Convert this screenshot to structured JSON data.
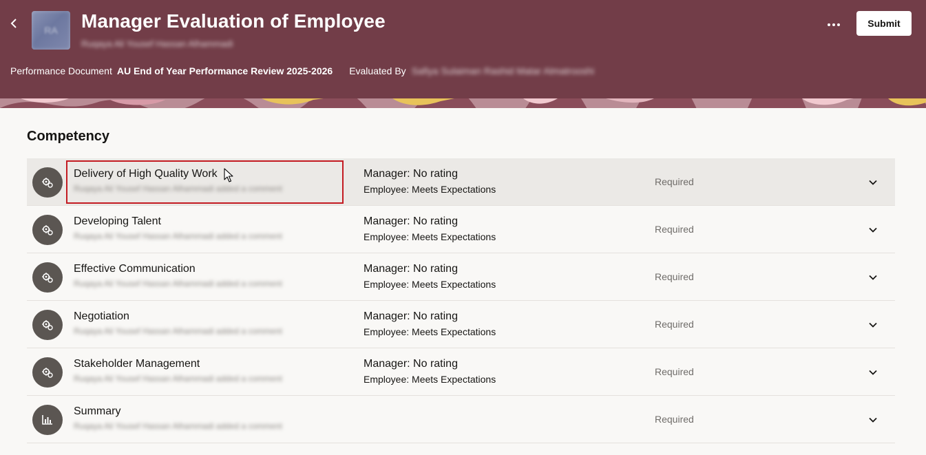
{
  "header": {
    "back_icon": "chevron-left-icon",
    "avatar_initials": "RA",
    "title": "Manager Evaluation of Employee",
    "subtitle": "Ruqaya Ali Yousef Hassan Alhammadi",
    "more_icon": "ellipsis-icon",
    "submit_label": "Submit",
    "performance_document_label": "Performance Document",
    "performance_document_value": "AU End of Year Performance Review 2025-2026",
    "evaluated_by_label": "Evaluated By",
    "evaluated_by_value": "Safiya Sulaiman Rashid Matar Almatrooshi",
    "background_color": "#723d48"
  },
  "main": {
    "section_title": "Competency",
    "rows": [
      {
        "name": "Delivery of High Quality Work",
        "comment": "Ruqaya Ali Yousef Hassan Alhammadi added a comment",
        "manager_rating": "Manager: No rating",
        "employee_rating": "Employee: Meets Expectations",
        "status": "Required",
        "icon": "competency-gear-icon",
        "selected": true
      },
      {
        "name": "Developing Talent",
        "comment": "Ruqaya Ali Yousef Hassan Alhammadi added a comment",
        "manager_rating": "Manager: No rating",
        "employee_rating": "Employee: Meets Expectations",
        "status": "Required",
        "icon": "competency-gear-icon"
      },
      {
        "name": "Effective Communication",
        "comment": "Ruqaya Ali Yousef Hassan Alhammadi added a comment",
        "manager_rating": "Manager: No rating",
        "employee_rating": "Employee: Meets Expectations",
        "status": "Required",
        "icon": "competency-gear-icon"
      },
      {
        "name": "Negotiation",
        "comment": "Ruqaya Ali Yousef Hassan Alhammadi added a comment",
        "manager_rating": "Manager: No rating",
        "employee_rating": "Employee: Meets Expectations",
        "status": "Required",
        "icon": "competency-gear-icon"
      },
      {
        "name": "Stakeholder Management",
        "comment": "Ruqaya Ali Yousef Hassan Alhammadi added a comment",
        "manager_rating": "Manager: No rating",
        "employee_rating": "Employee: Meets Expectations",
        "status": "Required",
        "icon": "competency-gear-icon"
      },
      {
        "name": "Summary",
        "comment": "Ruqaya Ali Yousef Hassan Alhammadi added a comment",
        "status": "Required",
        "icon": "summary-chart-icon"
      }
    ],
    "expand_icon": "chevron-down-icon"
  }
}
